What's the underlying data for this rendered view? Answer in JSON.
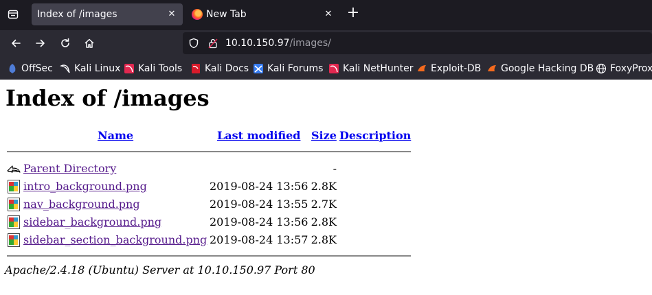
{
  "browser": {
    "tabs": [
      {
        "title": "Index of /images",
        "active": true
      },
      {
        "title": "New Tab",
        "active": false
      }
    ],
    "url": {
      "host": "10.10.150.97",
      "path": "/images/"
    },
    "bookmarks": [
      {
        "label": "OffSec",
        "icon": "offsec-icon"
      },
      {
        "label": "Kali Linux",
        "icon": "kali-dragon-icon"
      },
      {
        "label": "Kali Tools",
        "icon": "kali-tools-icon"
      },
      {
        "label": "Kali Docs",
        "icon": "kali-docs-icon"
      },
      {
        "label": "Kali Forums",
        "icon": "kali-forums-icon"
      },
      {
        "label": "Kali NetHunter",
        "icon": "nethunter-icon"
      },
      {
        "label": "Exploit-DB",
        "icon": "exploitdb-icon"
      },
      {
        "label": "Google Hacking DB",
        "icon": "ghdb-icon"
      },
      {
        "label": "FoxyProxy",
        "icon": "globe-icon"
      }
    ]
  },
  "page": {
    "title": "Index of /images",
    "columns": {
      "name": "Name",
      "last_modified": "Last modified",
      "size": "Size",
      "description": "Description"
    },
    "parent": {
      "name": "Parent Directory",
      "size": "-"
    },
    "files": [
      {
        "name": "intro_background.png",
        "modified": "2019-08-24 13:56",
        "size": "2.8K"
      },
      {
        "name": "nav_background.png",
        "modified": "2019-08-24 13:55",
        "size": "2.7K"
      },
      {
        "name": "sidebar_background.png",
        "modified": "2019-08-24 13:56",
        "size": "2.8K"
      },
      {
        "name": "sidebar_section_background.png",
        "modified": "2019-08-24 13:57",
        "size": "2.8K"
      }
    ],
    "footer": "Apache/2.4.18 (Ubuntu) Server at 10.10.150.97 Port 80"
  },
  "colors": {
    "tabbar_bg": "#1c1b22",
    "toolbar_bg": "#2b2a33",
    "link": "#0000ee",
    "visited_link": "#551a8b"
  }
}
